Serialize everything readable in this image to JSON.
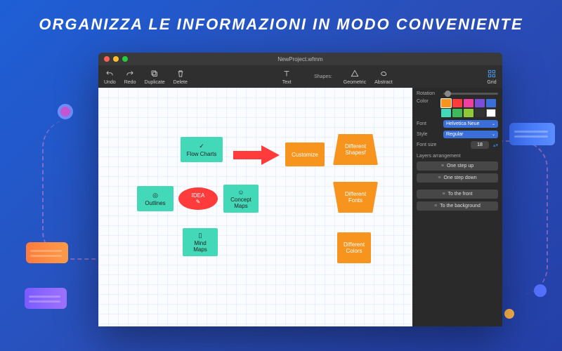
{
  "hero": {
    "title": "ORGANIZZA LE INFORMAZIONI IN MODO CONVENIENTE"
  },
  "window": {
    "title": "NewProject.wfmm"
  },
  "toolbar": {
    "undo": "Undo",
    "redo": "Redo",
    "duplicate": "Duplicate",
    "delete": "Delete",
    "text": "Text",
    "shapes_label": "Shapes:",
    "geometric": "Geometric",
    "abstract": "Abstract",
    "grid": "Grid"
  },
  "canvas": {
    "flow_charts": "Flow Charts",
    "outlines": "Outlines",
    "idea": "IDEA",
    "concept_maps": "Concept\nMaps",
    "mind_maps": "Mind\nMaps",
    "customize": "Customize",
    "diff_shapes": "Different\nShapesf",
    "diff_fonts": "Different\nFonts",
    "diff_colors": "Different\nColors"
  },
  "inspector": {
    "rotation": "Rotation",
    "color": "Color",
    "swatches": [
      "#f7941e",
      "#ff3b3b",
      "#ef3fa0",
      "#7a4ed8",
      "#3a6fd8",
      "#43d9b8",
      "#3fb85a",
      "#8fc93a",
      "#333333",
      "#ffffff"
    ],
    "font_label": "Font",
    "font_value": "Helvetica Neue",
    "style_label": "Style",
    "style_value": "Regular",
    "size_label": "Font size",
    "size_value": "18",
    "layers_title": "Layers arrangement",
    "step_up": "One step up",
    "step_down": "One step down",
    "to_front": "To the front",
    "to_back": "To the background"
  }
}
